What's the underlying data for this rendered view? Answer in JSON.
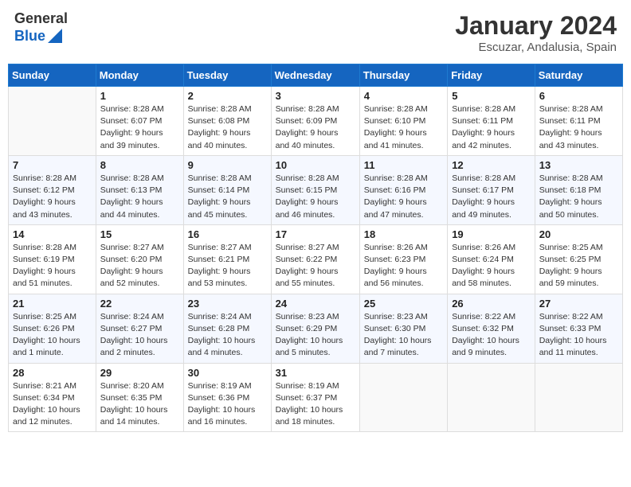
{
  "header": {
    "logo_general": "General",
    "logo_blue": "Blue",
    "month": "January 2024",
    "location": "Escuzar, Andalusia, Spain"
  },
  "weekdays": [
    "Sunday",
    "Monday",
    "Tuesday",
    "Wednesday",
    "Thursday",
    "Friday",
    "Saturday"
  ],
  "weeks": [
    [
      {
        "day": "",
        "info": ""
      },
      {
        "day": "1",
        "info": "Sunrise: 8:28 AM\nSunset: 6:07 PM\nDaylight: 9 hours\nand 39 minutes."
      },
      {
        "day": "2",
        "info": "Sunrise: 8:28 AM\nSunset: 6:08 PM\nDaylight: 9 hours\nand 40 minutes."
      },
      {
        "day": "3",
        "info": "Sunrise: 8:28 AM\nSunset: 6:09 PM\nDaylight: 9 hours\nand 40 minutes."
      },
      {
        "day": "4",
        "info": "Sunrise: 8:28 AM\nSunset: 6:10 PM\nDaylight: 9 hours\nand 41 minutes."
      },
      {
        "day": "5",
        "info": "Sunrise: 8:28 AM\nSunset: 6:11 PM\nDaylight: 9 hours\nand 42 minutes."
      },
      {
        "day": "6",
        "info": "Sunrise: 8:28 AM\nSunset: 6:11 PM\nDaylight: 9 hours\nand 43 minutes."
      }
    ],
    [
      {
        "day": "7",
        "info": "Sunrise: 8:28 AM\nSunset: 6:12 PM\nDaylight: 9 hours\nand 43 minutes."
      },
      {
        "day": "8",
        "info": "Sunrise: 8:28 AM\nSunset: 6:13 PM\nDaylight: 9 hours\nand 44 minutes."
      },
      {
        "day": "9",
        "info": "Sunrise: 8:28 AM\nSunset: 6:14 PM\nDaylight: 9 hours\nand 45 minutes."
      },
      {
        "day": "10",
        "info": "Sunrise: 8:28 AM\nSunset: 6:15 PM\nDaylight: 9 hours\nand 46 minutes."
      },
      {
        "day": "11",
        "info": "Sunrise: 8:28 AM\nSunset: 6:16 PM\nDaylight: 9 hours\nand 47 minutes."
      },
      {
        "day": "12",
        "info": "Sunrise: 8:28 AM\nSunset: 6:17 PM\nDaylight: 9 hours\nand 49 minutes."
      },
      {
        "day": "13",
        "info": "Sunrise: 8:28 AM\nSunset: 6:18 PM\nDaylight: 9 hours\nand 50 minutes."
      }
    ],
    [
      {
        "day": "14",
        "info": "Sunrise: 8:28 AM\nSunset: 6:19 PM\nDaylight: 9 hours\nand 51 minutes."
      },
      {
        "day": "15",
        "info": "Sunrise: 8:27 AM\nSunset: 6:20 PM\nDaylight: 9 hours\nand 52 minutes."
      },
      {
        "day": "16",
        "info": "Sunrise: 8:27 AM\nSunset: 6:21 PM\nDaylight: 9 hours\nand 53 minutes."
      },
      {
        "day": "17",
        "info": "Sunrise: 8:27 AM\nSunset: 6:22 PM\nDaylight: 9 hours\nand 55 minutes."
      },
      {
        "day": "18",
        "info": "Sunrise: 8:26 AM\nSunset: 6:23 PM\nDaylight: 9 hours\nand 56 minutes."
      },
      {
        "day": "19",
        "info": "Sunrise: 8:26 AM\nSunset: 6:24 PM\nDaylight: 9 hours\nand 58 minutes."
      },
      {
        "day": "20",
        "info": "Sunrise: 8:25 AM\nSunset: 6:25 PM\nDaylight: 9 hours\nand 59 minutes."
      }
    ],
    [
      {
        "day": "21",
        "info": "Sunrise: 8:25 AM\nSunset: 6:26 PM\nDaylight: 10 hours\nand 1 minute."
      },
      {
        "day": "22",
        "info": "Sunrise: 8:24 AM\nSunset: 6:27 PM\nDaylight: 10 hours\nand 2 minutes."
      },
      {
        "day": "23",
        "info": "Sunrise: 8:24 AM\nSunset: 6:28 PM\nDaylight: 10 hours\nand 4 minutes."
      },
      {
        "day": "24",
        "info": "Sunrise: 8:23 AM\nSunset: 6:29 PM\nDaylight: 10 hours\nand 5 minutes."
      },
      {
        "day": "25",
        "info": "Sunrise: 8:23 AM\nSunset: 6:30 PM\nDaylight: 10 hours\nand 7 minutes."
      },
      {
        "day": "26",
        "info": "Sunrise: 8:22 AM\nSunset: 6:32 PM\nDaylight: 10 hours\nand 9 minutes."
      },
      {
        "day": "27",
        "info": "Sunrise: 8:22 AM\nSunset: 6:33 PM\nDaylight: 10 hours\nand 11 minutes."
      }
    ],
    [
      {
        "day": "28",
        "info": "Sunrise: 8:21 AM\nSunset: 6:34 PM\nDaylight: 10 hours\nand 12 minutes."
      },
      {
        "day": "29",
        "info": "Sunrise: 8:20 AM\nSunset: 6:35 PM\nDaylight: 10 hours\nand 14 minutes."
      },
      {
        "day": "30",
        "info": "Sunrise: 8:19 AM\nSunset: 6:36 PM\nDaylight: 10 hours\nand 16 minutes."
      },
      {
        "day": "31",
        "info": "Sunrise: 8:19 AM\nSunset: 6:37 PM\nDaylight: 10 hours\nand 18 minutes."
      },
      {
        "day": "",
        "info": ""
      },
      {
        "day": "",
        "info": ""
      },
      {
        "day": "",
        "info": ""
      }
    ]
  ]
}
